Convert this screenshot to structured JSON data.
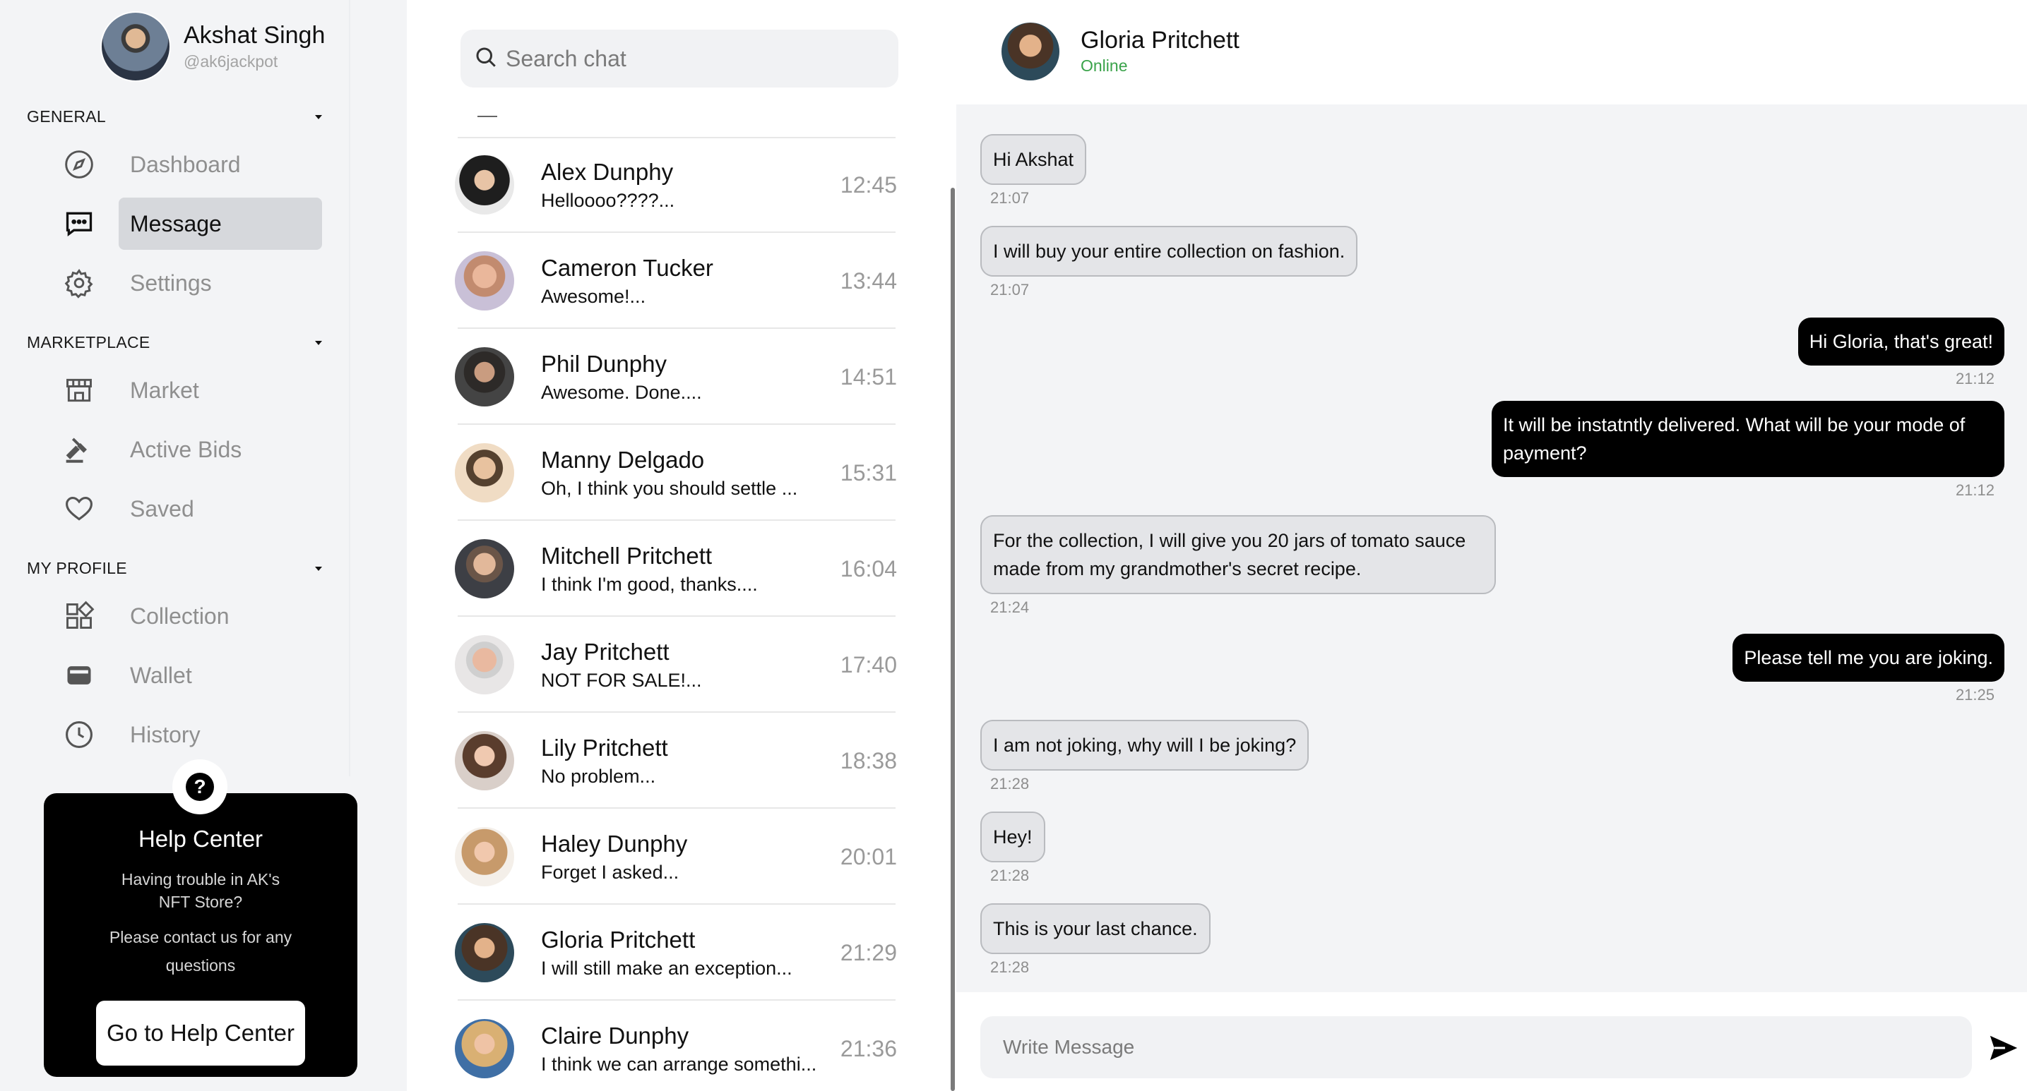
{
  "profile": {
    "name": "Akshat Singh",
    "handle": "@ak6jackpot"
  },
  "sections": {
    "general": "GENERAL",
    "marketplace": "MARKETPLACE",
    "my_profile": "MY PROFILE"
  },
  "nav": {
    "dashboard": "Dashboard",
    "message": "Message",
    "settings": "Settings",
    "market": "Market",
    "active_bids": "Active Bids",
    "saved": "Saved",
    "collection": "Collection",
    "wallet": "Wallet",
    "history": "History"
  },
  "help": {
    "icon_text": "?",
    "title": "Help Center",
    "line1": "Having trouble in AK's",
    "line2": "NFT Store?",
    "line3": "Please contact us for any",
    "line4": "questions",
    "button": "Go to Help Center"
  },
  "search": {
    "placeholder": "Search chat"
  },
  "conversations": [
    {
      "name": "Alex Dunphy",
      "preview": "Helloooo????...",
      "time": "12:45"
    },
    {
      "name": "Cameron Tucker",
      "preview": "Awesome!...",
      "time": "13:44"
    },
    {
      "name": "Phil Dunphy",
      "preview": "Awesome. Done....",
      "time": "14:51"
    },
    {
      "name": "Manny Delgado",
      "preview": "Oh, I think you should settle ...",
      "time": "15:31"
    },
    {
      "name": "Mitchell Pritchett",
      "preview": "I think I'm good, thanks....",
      "time": "16:04"
    },
    {
      "name": "Jay Pritchett",
      "preview": "NOT FOR SALE!...",
      "time": "17:40"
    },
    {
      "name": "Lily Pritchett",
      "preview": "No problem...",
      "time": "18:38"
    },
    {
      "name": "Haley Dunphy",
      "preview": "Forget I asked...",
      "time": "20:01"
    },
    {
      "name": "Gloria Pritchett",
      "preview": "I will still make an exception...",
      "time": "21:29"
    },
    {
      "name": "Claire Dunphy",
      "preview": "I think we can arrange somethi...",
      "time": "21:36"
    }
  ],
  "chat": {
    "contact_name": "Gloria Pritchett",
    "status": "Online",
    "status_color": "#3aa34a",
    "messages": [
      {
        "dir": "in",
        "text": "Hi Akshat",
        "time": "21:07"
      },
      {
        "dir": "in",
        "text": "I will buy your entire collection on fashion.",
        "time": "21:07"
      },
      {
        "dir": "out",
        "text": "Hi Gloria, that's great!",
        "time": "21:12"
      },
      {
        "dir": "out",
        "text": "It will be instatntly delivered. What will be your mode of payment?",
        "time": "21:12"
      },
      {
        "dir": "in",
        "text": "For the collection, I will give you 20 jars of tomato sauce made from my grandmother's secret recipe.",
        "time": "21:24"
      },
      {
        "dir": "out",
        "text": "Please tell me you are joking.",
        "time": "21:25"
      },
      {
        "dir": "in",
        "text": "I am not joking, why will I be joking?",
        "time": "21:28"
      },
      {
        "dir": "in",
        "text": "Hey!",
        "time": "21:28"
      },
      {
        "dir": "in",
        "text": "This is your last chance.",
        "time": "21:28"
      }
    ],
    "composer_placeholder": "Write Message"
  }
}
